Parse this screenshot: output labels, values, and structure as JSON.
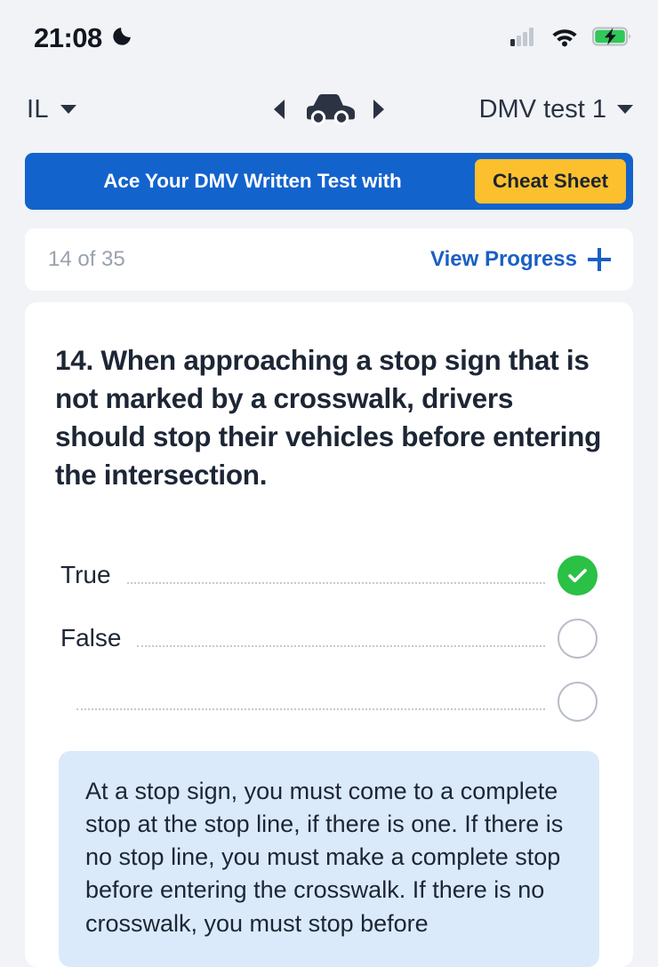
{
  "status_bar": {
    "time": "21:08",
    "moon_icon": "crescent-moon-icon",
    "signal_icon": "cellular-signal-icon",
    "wifi_icon": "wifi-icon",
    "battery_icon": "battery-charging-icon",
    "battery_color": "#32c759"
  },
  "nav": {
    "state": "IL",
    "state_caret_icon": "chevron-down-icon",
    "prev_icon": "triangle-left-icon",
    "car_icon": "car-icon",
    "next_icon": "triangle-right-icon",
    "test_name": "DMV test 1",
    "test_caret_icon": "chevron-down-icon"
  },
  "banner": {
    "text": "Ace Your DMV Written Test with",
    "cta_label": "Cheat Sheet",
    "bg_color": "#1363cd",
    "cta_color": "#fcc02e"
  },
  "progress": {
    "count_label": "14 of 35",
    "current": 14,
    "total": 35,
    "view_progress_label": "View Progress",
    "plus_icon": "plus-icon",
    "link_color": "#1b5fc4"
  },
  "question": {
    "number": "14.",
    "text": "14. When approaching a stop sign that is not marked by a crosswalk, drivers should stop their vehicles before entering the intersection.",
    "answers": [
      {
        "label": "True",
        "state": "correct",
        "marker_icon": "check-circle-icon"
      },
      {
        "label": "False",
        "state": "empty",
        "marker_icon": "empty-circle-icon"
      },
      {
        "label": "",
        "state": "empty",
        "marker_icon": "empty-circle-icon"
      }
    ],
    "correct_color": "#2bc046"
  },
  "explanation": {
    "text": "At a stop sign, you must come to a complete stop at the stop line, if there is one. If there is no stop line, you must make a complete stop before entering the crosswalk. If there is no crosswalk, you must stop before",
    "bg_color": "#daeafa"
  }
}
